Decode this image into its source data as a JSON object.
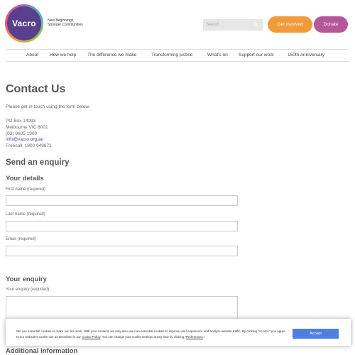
{
  "header": {
    "logo_text": "Vacro",
    "tagline_line1": "New Beginnings,",
    "tagline_line2": "Stronger Communities",
    "search_placeholder": "Search",
    "get_involved_label": "Get involved",
    "donate_label": "Donate"
  },
  "nav": {
    "items": [
      "About",
      "How we help",
      "The difference we make",
      "Transforming justice",
      "What's on",
      "Support our work",
      "150th Anniversary"
    ]
  },
  "main": {
    "title": "Contact Us",
    "intro": "Please get in touch using the form below.",
    "address": {
      "line1": "PO Box 14093",
      "line2": "Melbourne VIC 8001",
      "phone": "(03) 9605 1900",
      "email": "info@vacro.org.au",
      "freecall": "Freecall: 1800 049871"
    },
    "send_heading": "Send an enquiry",
    "details_heading": "Your details",
    "first_name_label": "First name (required)",
    "last_name_label": "Last name (required)",
    "email_label": "Email (required)",
    "enquiry_heading": "Your enquiry",
    "enquiry_label": "Your enquiry (required)",
    "additional_heading": "Additional information"
  },
  "cookie": {
    "text_part1": "We use essential cookies to make our site work. With your consent, we may also use non-essential cookies to improve user experience and analyze website traffic. By clicking \"Accept,\" you agree to our website's cookie use as described in our ",
    "policy_link": "Cookie Policy",
    "text_part2": ". You can change your cookie settings at any time by clicking \"",
    "preferences_link": "Preferences",
    "text_part3": ".\"",
    "accept_label": "Accept"
  },
  "colors": {
    "brand_purple": "#5a3f8e",
    "orange": "#f39a3a",
    "magenta": "#b5589a",
    "accept_blue": "#4e7fe0"
  }
}
